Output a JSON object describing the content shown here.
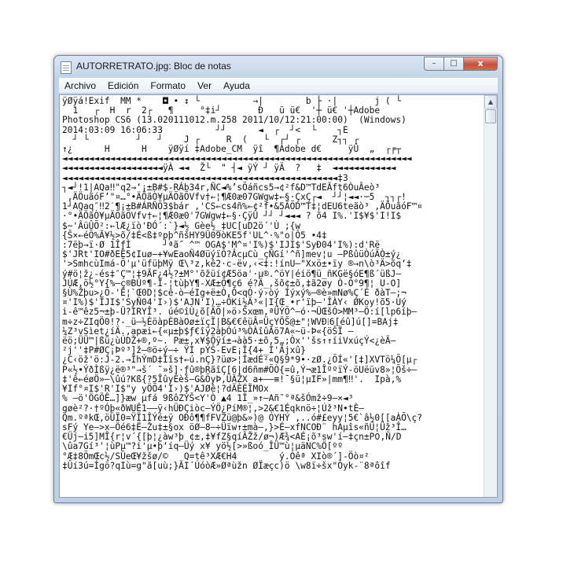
{
  "window": {
    "title": "AUTORRETRATO.jpg: Bloc de notas",
    "controls": {
      "minimize": "–",
      "maximize": "□",
      "close": "x"
    }
  },
  "menu": {
    "items": [
      "Archivo",
      "Edición",
      "Formato",
      "Ver",
      "Ayuda"
    ]
  },
  "editor": {
    "lines": [
      "ÿØÿá!Exif  MM *    ◘ • ↕ └          →|        b ├ ·|       j ( └",
      "  1   ┌  H  r  2┌   ¶     °‡i┘       Ð   ü ü€  '┼ ü€ '┼Adobe",
      "Photoshop CS6 (13.020111012.m.258 2011/10/12:21:00:00)  (Windows)",
      "2014:03:09 16:06:33          ┘┘      ◄  ┌  ┘<  └    ┐Ε",
      "  ┘ └         ┘   ┘    J ┌     R  (   └  ┌┘ ┌      Z┐┐ ┌",
      "↑¿      H      H    ÿØÿí ‡Adobe_CM  ÿî  ¶Adobe d€     ÿÛ  „  ┌╒┬",
      "◄◄◄◄◄◄◄◄◄◄◄◄◄◄◄◄◄◄◄◄◄◄◄◄◄◄◄◄◄◄◄◄◄◄◄◄◄◄◄◄◄◄◄◄◄◄◄◄◄◄◄◄◄◄◄◄◄◄◄◄◄◄◄◄◄◄",
      "◄◄◄◄◄◄◄◄◄◄◄◄◄◄◄◄◄◄◄ÿÀ ◄◄  Ž└  \" ┤◄ ÿÝ ┘ ÿÄ  ?   ‡  ◄◄◄◄◄◄◄◄◄◄◄◄",
      "◄◄◄◄◄◄◄◄◄◄◄◄◄◄◄◄◄◄◄◄◄◄◄◄◄◄◄◄◄◄◄◄◄◄◄◄◄◄◄◄◄◄◄◄◄◄◄◄◄◄◄◄‡3",
      "┐◄┘!1|AQa‼\"q2→‘¡±B#$-RÁb34r‚ÑC◄%’sÕáñcs5→¢²f&D™TdEÃft6ÒuÂeò³",
      " ‚ÄÖuãóF’\"¤…°•ÄÖãÒ¥µÄÕãÕVfv†←¦¶Æ0æ07GWgw‡←§·ÇxÇ┌◄  ┘┘¦◄◄·─5  ┐┐┌!",
      "1┘AQaq″‼2′¶¡±B#ÁRÑÕ3$bár ‚'CS←cs4ñ%←¢²f•&5ÄÕD™T‡¦dEU6teãò³ ‚ÄÖuãóF™¤",
      "·°•ÄÖãÒ¥µÄÕãÕVfv†←¦¶Æ0æ0'7GWgw‡←§·ÇÿÛ ┘┘ ┘◄◄◄ ? õ4 I%.'I$¥$'I!I$",
      "$~'ÂüÛÕ²:←lÆ¿ïò'ÐÓ´:`}◄½ Gèe½_‡UC[uD2ö´'Ù ;{w",
      "{Š×←éÕ%Ã¥½>õ/‡É<ß‡ºpþ^ñšHY9Ü09òKE5f'UL^·%\"o|Ô5 •4‡",
      ":7ëþ→ï·Ø 1ÎƒÌ      ┘ªã˝ ^™ OGA$'M^¤'I%)$'IJI$'SyÐ04'I%):d'Rë",
      "$'JRt'IO#ðEÊ5¢Iuø−+¥wEaoÑ4ØüýïÕ?ÂcµCù_çÑGí'^ñ]mev¦u –PßûüÒúÄÒ±ý¿",
      "'>SmhcùImá-Õ'µ'üfüþMÿ Œ\\³z,kê2·c-ëv‚‹<‡:!ínU—\"Xxö±•ïy ®→n\\ò³Ä>õq‘‡",
      "ý#ö¦ž¿-és‡″Ç™¦‡9ÃF¿4½?±M°'õžüí¢Æ5öa'·µ®.^öY|éiö¶ü_ñKGë§óE¶ß´üßJ–",
      "JÚÆ,ö½°Y{%—ç®BÚº¶-Ï-¦tùþY¶-XÆ±Õ¶ç6 é?Ä_‚šõ¢±õ,‡ã2øy Ò-Ó°9¶¦ U-O]",
      "§Ù%Žþu>¿Õ-'Ë¦`Œ0D¦$cê-ò—éIg+ë±Ò‚Ò<qÓ·ý›òý Íýxý%—®è»mNø%Ç´É ðàT–;¬",
      "¤'I%)$'IJI$'SyÑ04'I›)$'AJN'I)…÷ÔKi½Ä³«|I{Œ •r'ïþ—'ÎÀY‹ ØKoy!õ5·Ùý",
      "i-ê™êz5¬±þ-Ü?IRYÎ³. úé©îÙ¿õ[ÄÕ|»ö›Šxœm‚ªÜÝÕ^–ó·¬ÜŒšÓ>MM³–Ö:í[lp6íþ–",
      "m÷z÷ZIqÖ0!?-_ü—½ÈöàpÈBàOø±ïçÏ|B&€€êüÂ¤ÜçYÖŠ@±\"¦WVÐ⁞6[éû]ú[]=BAj‡",
      "¼Z³vSìet¿íÄ.,apæi←{«µ±þ$ƒ€îÿ2àþÓú³%ÒÀîûÃö7A«~ü-Þ«{öŠÏ –",
      "ëö;ÜÜ™|ßü¿ùÚDŽ+®‚º~. Pæ±‚x¥$Öÿí±→àà5·±õ‚5„;Òx''šs↑↑íiVxúçÝ<¿èÄ–",
      "²j''‡P#ØÇ¡Þº³]ž–®ö÷ý–÷ ŸÌ pÝŠ-EvE¡Î{4+_Ì'Ãjxû}",
      "¿C‹öž'ö:J-2.→ÎhÝmD‡Ìîs†←ú.nÇ}?üø>¦ÍædÉ²«Q§9*9•·zØ.¿ÕÍ«'[‡]XVTö¼Õ[µ┌",
      "P«½•ÝðÌßÿ¿ë®³\"→š´ ˜»š]·ƒû®þRãîÇ[6|d6ñm#ÕÒ{=û‚Ý¬æ1ÎººïÝ-öUëüv8»¦Õš÷–",
      "‡'ê←éøÖ»–\\ûú?Kß{?5ÎûyÉèš–G&ÕyÞ‚ÜÄŽX a+——≡!¯§ü¦µIF»|mm¶‼'.  Ipà‚%",
      "¥If°¤I$'R'I$\"y yÖÕ4'I›)$'AJØê¦?dÄÈÉÏMOx",
      "% –ö'ÖGÖÊ…]}æw µfá 9ßôZÝŠ<Y'Ò ▲4 1Î_»↑—Añ˜°ª&šÓmž÷9–×◄³",
      "gøè²?·†ºÓþ«ðWUÊ1——ÿ‹hÜÐÇiòc–ÝÖ¿PíM®¦,>2&€1Éqknö÷¦Úž³N•tÈ–",
      "Qm.ºªkŒ‚öÚÏ0=ŸÏ1ÎÝé±ÿ OÐô¶¶fFVZü@þ&»)@ ÓYHÝ ‚..ó#£eyy¦5€`â½0[[aÀÕ\\ç?",
      "sFý Ye–>x–Öé6‡Ë–Žu‡±§ox öØ–8—÷Üïw↑±mà–‚}>É–xfNCOÐ¨ hAµîs«ñÜ¦Üž³Î…",
      "€Üj–i5]MÎ{r¦v´{[þ¦¿àw³þ ¢±‚‡¥fZ§qíÂŽž/ø¬)Æ¾<AÉ¡õ³sw'í–‡çn±P߀‚Ñ/D",
      "\\ûa7Gí³'¦ùPµ™?i'µ•þ‘íq–Üý x¥ yö½[>»ßoó_ÎÜ™ù¦µäNC%Ö[ºº",
      "°Æ‡8ÕmŒc½/SÛeŒ¥žšø/©   Q=tê³XÆ€H4        ý.Óêª XIò®´]-Öò¤²",
      "‡Ûí3ú=Ígö?qIù=g\"ã[uù;}ÃI´ÚóòÆ»Øªùžn ØÏæçc)ö \\w8ï÷šx\"Óyk-¨8ªôîf"
    ]
  }
}
